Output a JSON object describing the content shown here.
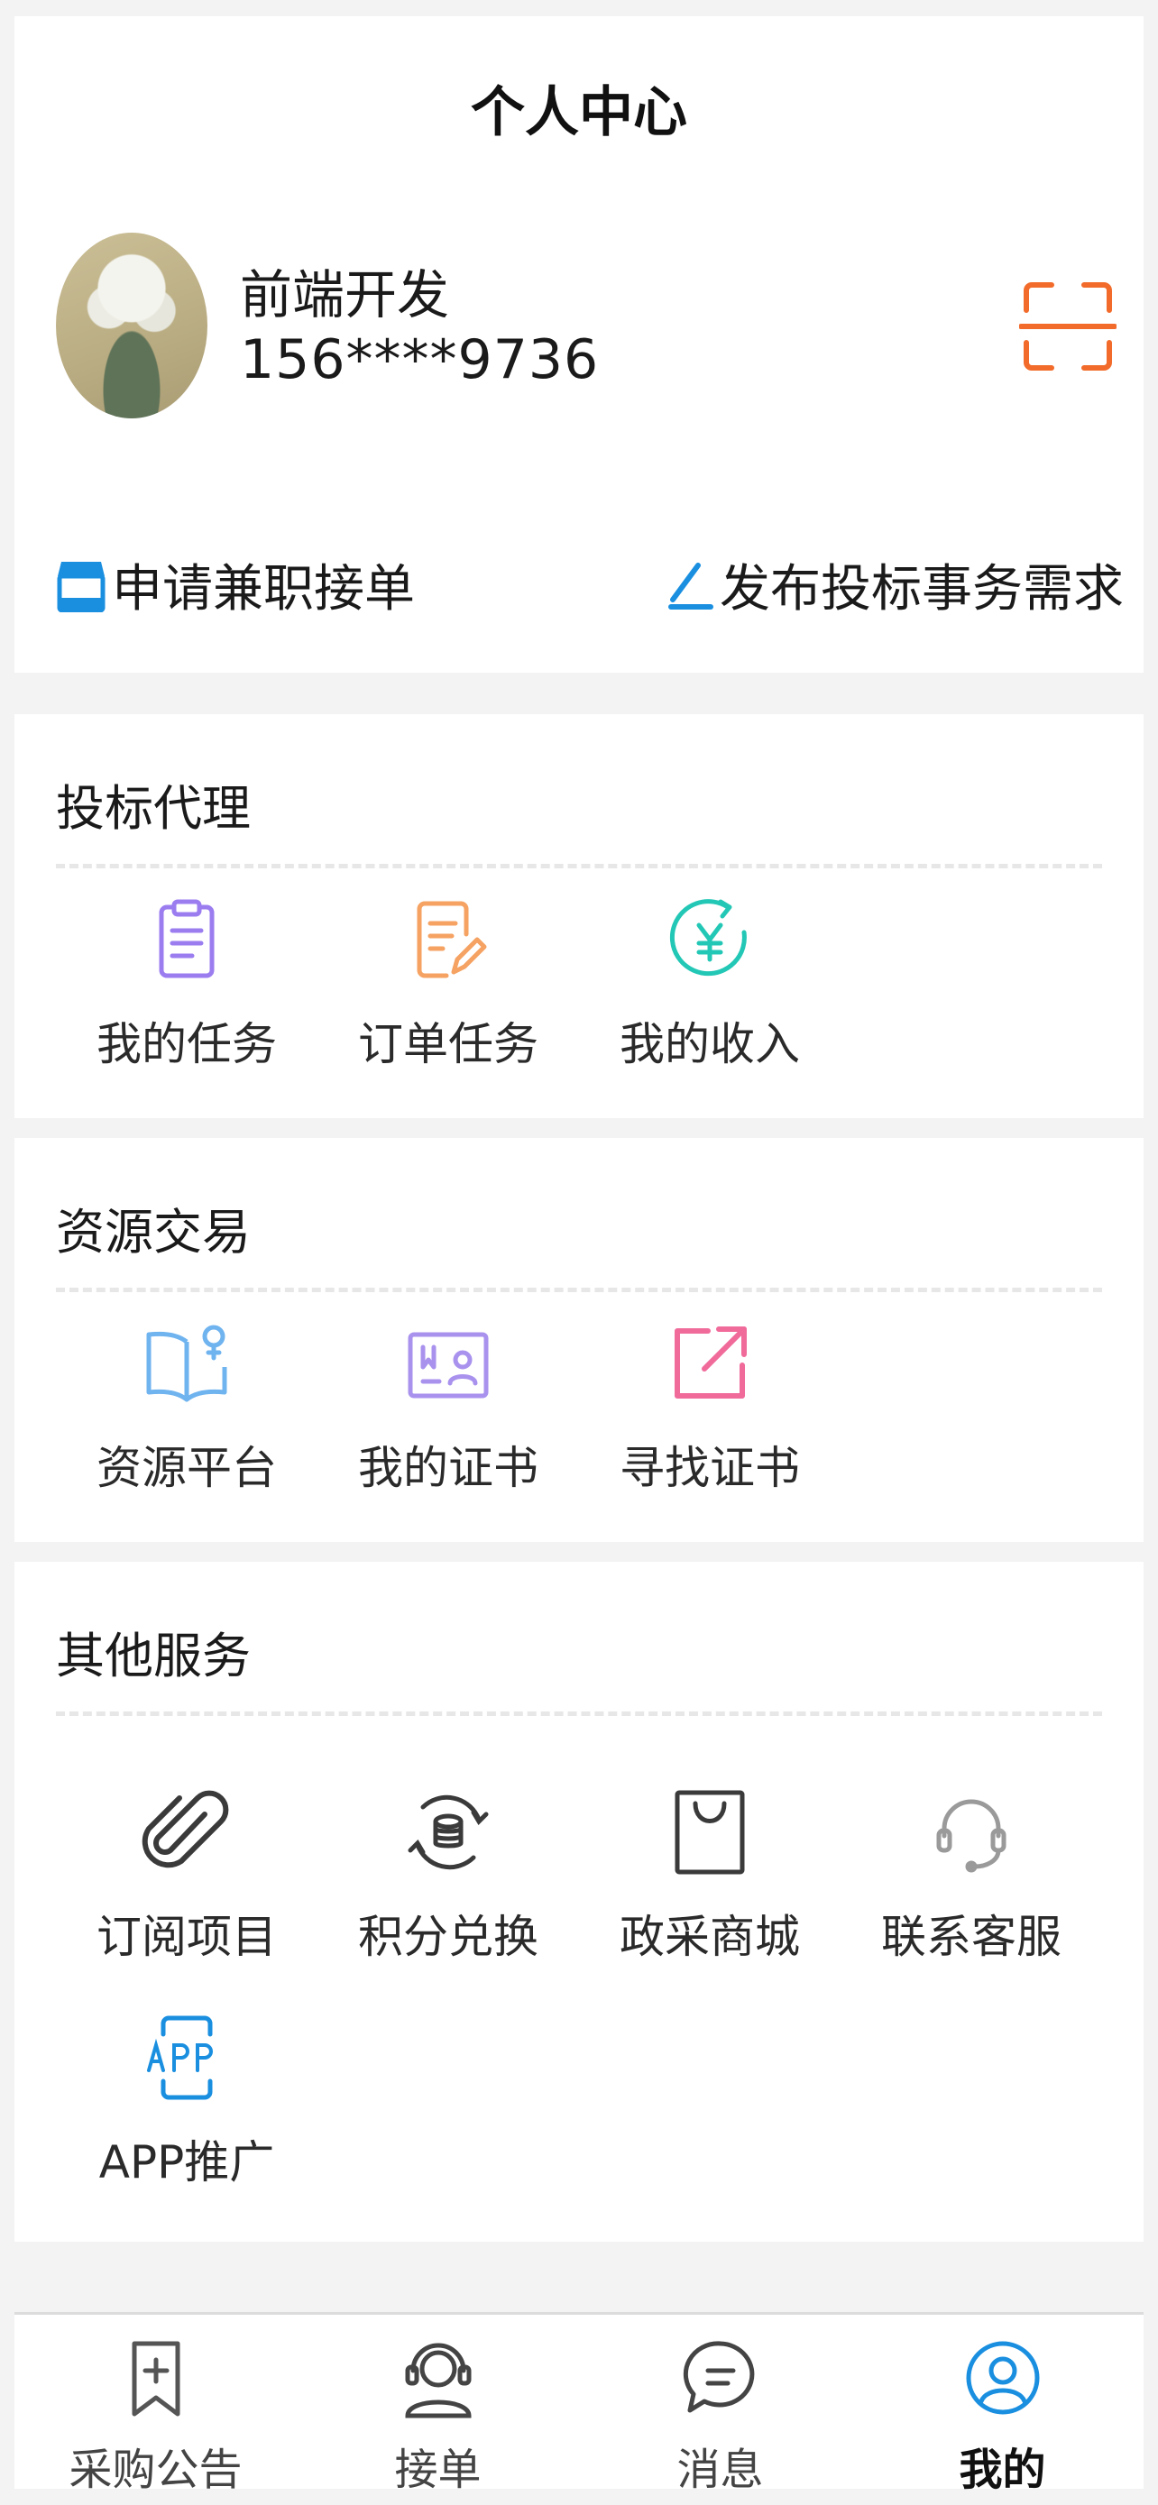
{
  "header": {
    "title": "个人中心"
  },
  "profile": {
    "name": "前端开发",
    "phone": "156****9736",
    "scan_icon": "scan-icon"
  },
  "actions": {
    "apply_label": "申请兼职接单",
    "publish_label": "发布投标事务需求"
  },
  "sections": [
    {
      "title": "投标代理",
      "items": [
        {
          "label": "我的任务",
          "icon": "clipboard-icon"
        },
        {
          "label": "订单任务",
          "icon": "edit-document-icon"
        },
        {
          "label": "我的收入",
          "icon": "yuan-refresh-icon"
        }
      ]
    },
    {
      "title": "资源交易",
      "items": [
        {
          "label": "资源平台",
          "icon": "open-book-icon"
        },
        {
          "label": "我的证书",
          "icon": "certificate-icon"
        },
        {
          "label": "寻找证书",
          "icon": "external-link-icon"
        }
      ]
    },
    {
      "title": "其他服务",
      "items": [
        {
          "label": "订阅项目",
          "icon": "paperclip-icon"
        },
        {
          "label": "积分兑换",
          "icon": "coins-exchange-icon"
        },
        {
          "label": "政采商城",
          "icon": "shopping-bag-icon"
        },
        {
          "label": "联系客服",
          "icon": "headset-icon"
        },
        {
          "label": "APP推广",
          "icon": "app-icon"
        }
      ]
    }
  ],
  "tabbar": {
    "active_index": 3,
    "tabs": [
      {
        "label": "采购公告",
        "icon": "bookmark-plus-icon"
      },
      {
        "label": "接单",
        "icon": "agent-icon"
      },
      {
        "label": "消息",
        "icon": "chat-bubble-icon"
      },
      {
        "label": "我的",
        "icon": "user-circle-icon"
      }
    ]
  },
  "colors": {
    "accent_blue": "#1a8fe0",
    "scan_orange": "#f26b2a",
    "purple": "#9b7df0",
    "orange": "#f5a262",
    "teal": "#23c7b5",
    "blue_light": "#6fb3ef",
    "violet": "#a992ee",
    "pink": "#f06a9a",
    "dark": "#3a3a3a"
  }
}
